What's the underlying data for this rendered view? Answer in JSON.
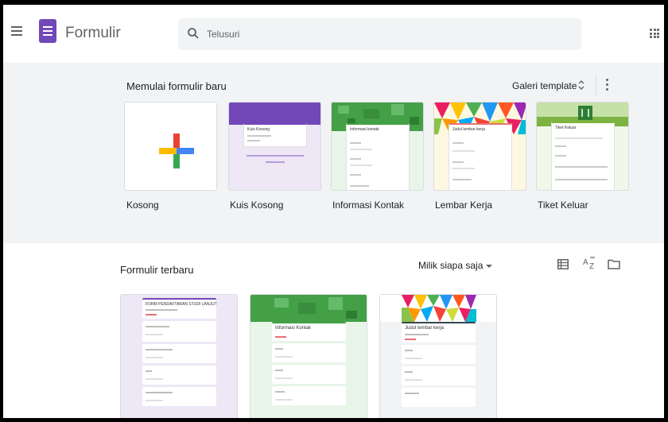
{
  "app": {
    "title": "Formulir"
  },
  "search": {
    "placeholder": "Telusuri"
  },
  "gallery": {
    "title": "Memulai formulir baru",
    "gallery_label": "Galeri template",
    "templates": [
      {
        "label": "Kosong",
        "icon": "plus-icon"
      },
      {
        "label": "Kuis Kosong",
        "card_title": "Kuis Kosong",
        "accent": "#7248b9"
      },
      {
        "label": "Informasi Kontak",
        "card_title": "Informasi kontak",
        "accent": "#4caf50"
      },
      {
        "label": "Lembar Kerja",
        "card_title": "Judul lembar kerja",
        "accent": "#e57373"
      },
      {
        "label": "Tiket Keluar",
        "card_title": "Tiket Keluar",
        "accent": "#8bc34a"
      }
    ]
  },
  "recent": {
    "title": "Formulir terbaru",
    "owner_filter": "Milik siapa saja",
    "docs": [
      {
        "card_title": "FORM PENDAFTARAN STUDI LANJUT",
        "accent": "#7248b9"
      },
      {
        "card_title": "Informasi Kontak",
        "accent": "#4caf50"
      },
      {
        "card_title": "Judul lembar kerja",
        "accent": "#ff7043"
      }
    ]
  },
  "colors": {
    "brand": "#7248b9",
    "gallery_bg": "#f1f3f4",
    "text": "#202124"
  }
}
